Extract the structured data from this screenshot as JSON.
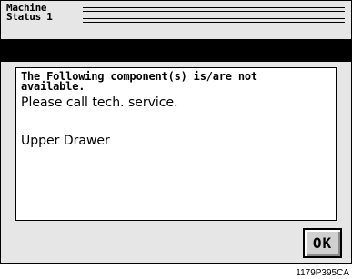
{
  "header": {
    "title_line1": "Machine",
    "title_line2": "Status 1"
  },
  "dialog": {
    "message_line1": "The Following component(s) is/are not",
    "message_line2": "available.",
    "message_line3": "Please call tech. service.",
    "items": [
      "Upper Drawer"
    ]
  },
  "buttons": {
    "ok_label": "OK"
  },
  "footer": {
    "code": "1179P395CA"
  }
}
